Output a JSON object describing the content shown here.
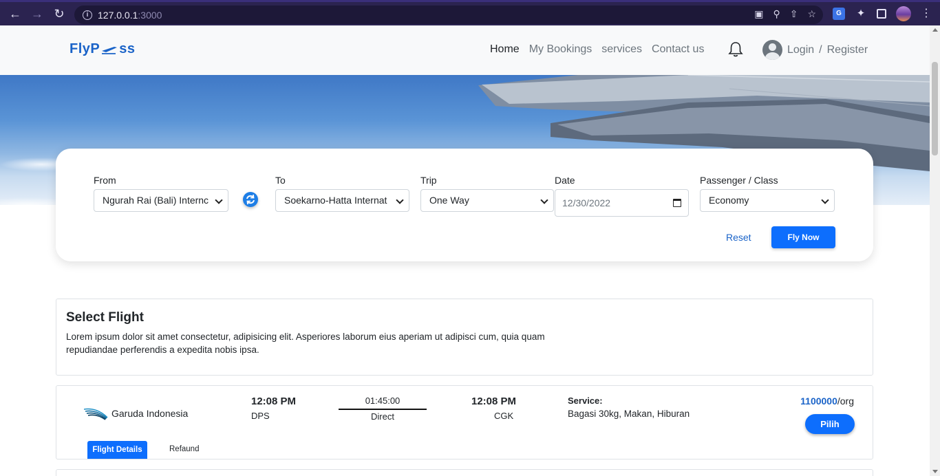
{
  "browser": {
    "url_host": "127.0.0.1",
    "url_port": ":3000"
  },
  "navbar": {
    "logo": {
      "left": "FlyP",
      "right": "ss"
    },
    "links": [
      {
        "label": "Home",
        "active": true
      },
      {
        "label": "My Bookings",
        "active": false
      },
      {
        "label": "services",
        "active": false
      },
      {
        "label": "Contact us",
        "active": false
      }
    ],
    "login": "Login",
    "separator": "/",
    "register": "Register"
  },
  "search": {
    "from": {
      "label": "From",
      "value": "Ngurah Rai (Bali) Internc"
    },
    "to": {
      "label": "To",
      "value": "Soekarno-Hatta Internat"
    },
    "trip": {
      "label": "Trip",
      "value": "One Way"
    },
    "date": {
      "label": "Date",
      "value": "12/30/2022"
    },
    "passenger": {
      "label": "Passenger / Class",
      "value": "Economy"
    },
    "reset": "Reset",
    "submit": "Fly Now"
  },
  "select_flight": {
    "title": "Select Flight",
    "description": "Lorem ipsum dolor sit amet consectetur, adipisicing elit. Asperiores laborum eius aperiam ut adipisci cum, quia quam repudiandae perferendis a expedita nobis ipsa."
  },
  "flight": {
    "airline": "Garuda Indonesia",
    "depart_time": "12:08 PM",
    "depart_code": "DPS",
    "duration": "01:45:00",
    "stops": "Direct",
    "arrive_time": "12:08 PM",
    "arrive_code": "CGK",
    "service_label": "Service:",
    "service_value": "Bagasi 30kg, Makan, Hiburan",
    "price": "1100000",
    "price_unit": "/org",
    "choose": "Pilih",
    "tabs": [
      "Flight Details",
      "Refaund"
    ]
  },
  "colors": {
    "primary": "#0d6efd",
    "brand": "#1a63c8",
    "chrome": "#2b2350"
  }
}
